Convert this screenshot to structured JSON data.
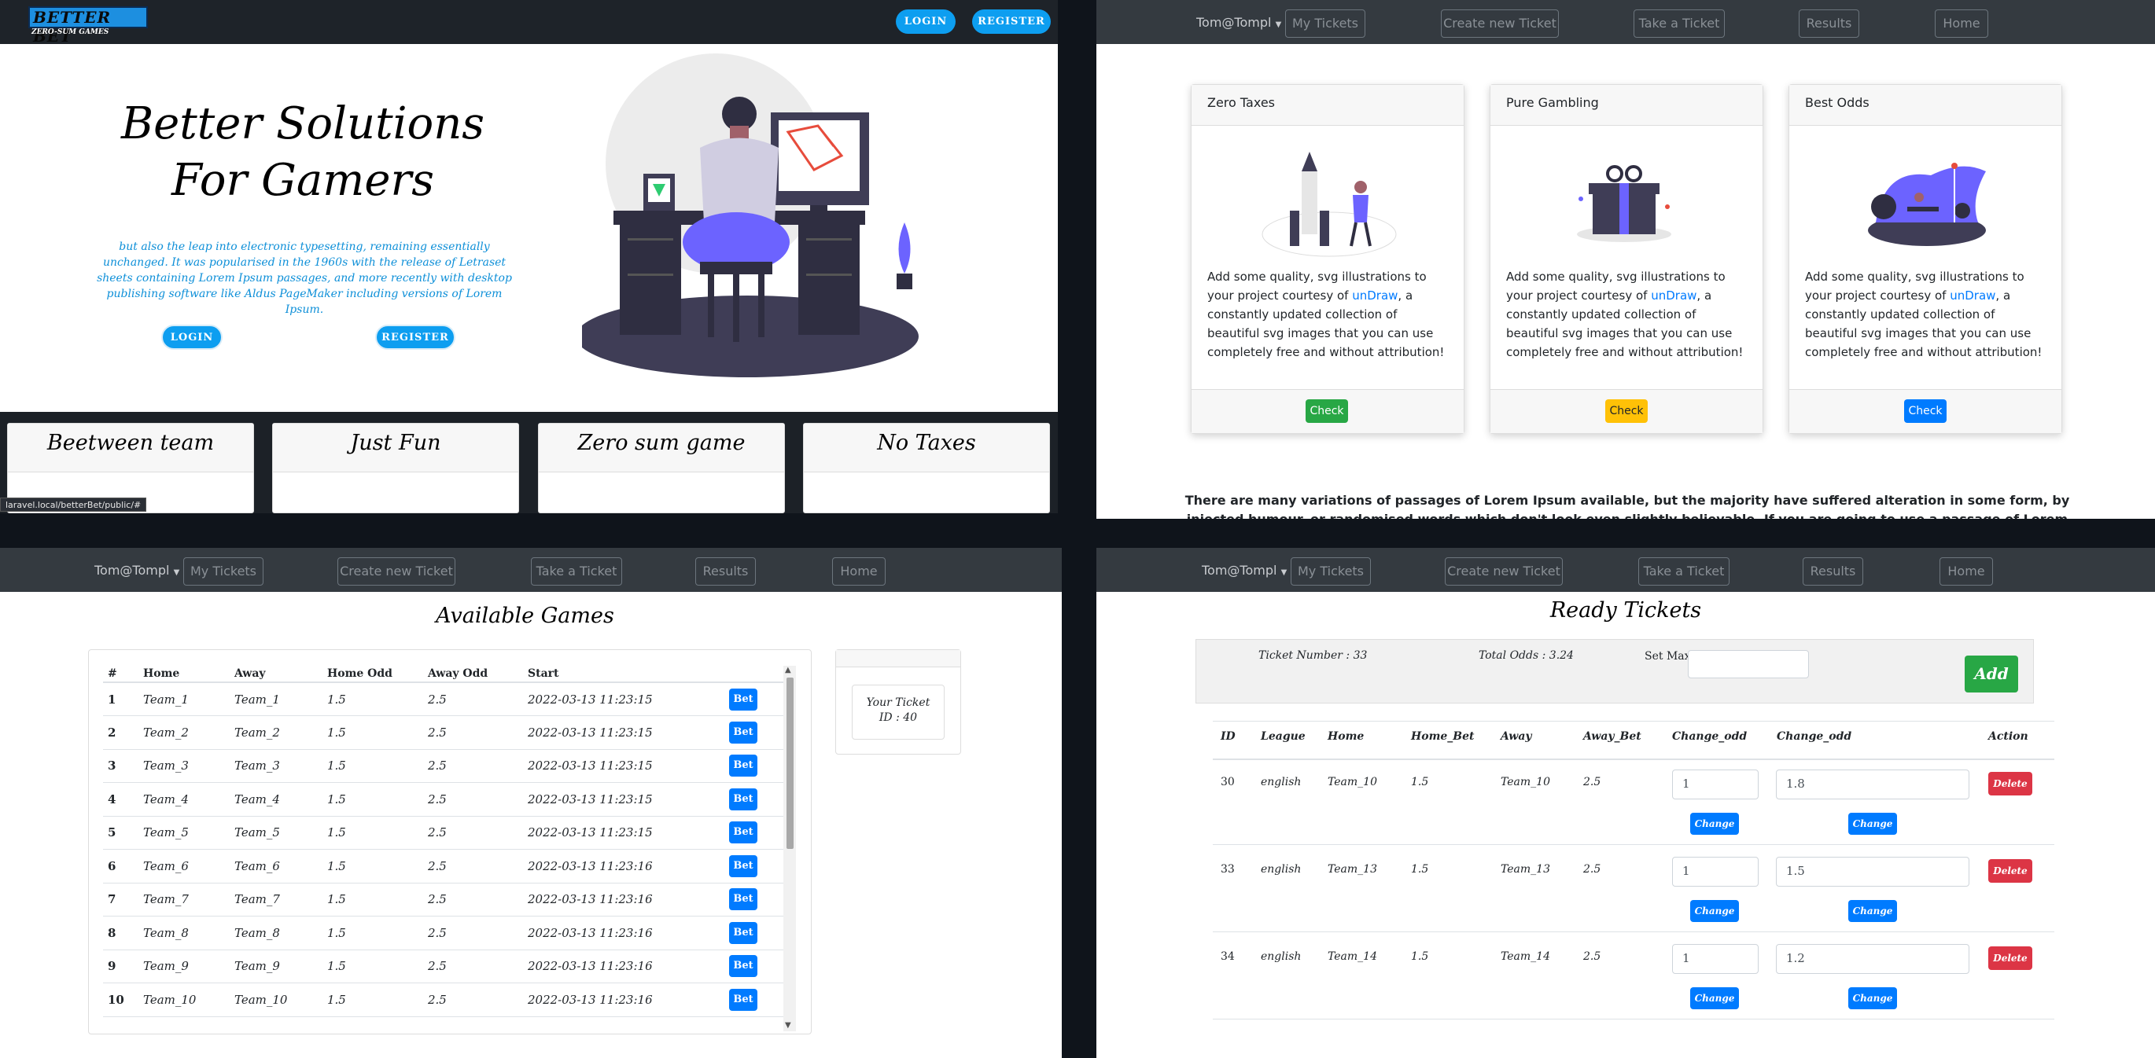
{
  "landing": {
    "brand": "BETTER BET",
    "brand_sub": "ZERO-SUM GAMES",
    "top_login": "LOGIN",
    "top_register": "REGISTER",
    "hero_title": "Better Solutions For Gamers",
    "hero_text": "but also the leap into electronic typesetting, remaining essentially unchanged. It was popularised in the 1960s with the release of Letraset sheets containing Lorem Ipsum passages, and more recently with desktop publishing software like Aldus PageMaker including versions of Lorem Ipsum.",
    "hero_login": "LOGIN",
    "hero_register": "REGISTER",
    "features": [
      "Beetween team",
      "Just Fun",
      "Zero sum game",
      "No Taxes"
    ],
    "status_url": "laravel.local/betterBet/public/#"
  },
  "nav": {
    "user": "Tom@Tompl",
    "items": [
      "My Tickets",
      "Create new Ticket",
      "Take a Ticket",
      "Results",
      "Home"
    ]
  },
  "home": {
    "cards": [
      {
        "title": "Zero Taxes",
        "text_before": "Add some quality, svg illustrations to your project courtesy of ",
        "link": "unDraw",
        "text_after": ", a constantly updated collection of beautiful svg images that you can use completely free and without attribution!",
        "button": "Check",
        "button_color": "#28a745"
      },
      {
        "title": "Pure Gambling",
        "text_before": "Add some quality, svg illustrations to your project courtesy of ",
        "link": "unDraw",
        "text_after": ", a constantly updated collection of beautiful svg images that you can use completely free and without attribution!",
        "button": "Check",
        "button_color": "#ffc107"
      },
      {
        "title": "Best Odds",
        "text_before": "Add some quality, svg illustrations to your project courtesy of ",
        "link": "unDraw",
        "text_after": ", a constantly updated collection of beautiful svg images that you can use completely free and without attribution!",
        "button": "Check",
        "button_color": "#007bff"
      }
    ],
    "lorem": "There are many variations of passages of Lorem Ipsum available, but the majority have suffered alteration in some form, by injected humour, or randomised words which don't look even slightly believable. If you are going to use a passage of Lorem Ipsum, you need to be sure there isn't anything"
  },
  "games": {
    "title": "Available Games",
    "headers": [
      "#",
      "Home",
      "Away",
      "Home Odd",
      "Away Odd",
      "Start"
    ],
    "bet_label": "Bet",
    "rows": [
      [
        "1",
        "Team_1",
        "Team_1",
        "1.5",
        "2.5",
        "2022-03-13 11:23:15"
      ],
      [
        "2",
        "Team_2",
        "Team_2",
        "1.5",
        "2.5",
        "2022-03-13 11:23:15"
      ],
      [
        "3",
        "Team_3",
        "Team_3",
        "1.5",
        "2.5",
        "2022-03-13 11:23:15"
      ],
      [
        "4",
        "Team_4",
        "Team_4",
        "1.5",
        "2.5",
        "2022-03-13 11:23:15"
      ],
      [
        "5",
        "Team_5",
        "Team_5",
        "1.5",
        "2.5",
        "2022-03-13 11:23:15"
      ],
      [
        "6",
        "Team_6",
        "Team_6",
        "1.5",
        "2.5",
        "2022-03-13 11:23:16"
      ],
      [
        "7",
        "Team_7",
        "Team_7",
        "1.5",
        "2.5",
        "2022-03-13 11:23:16"
      ],
      [
        "8",
        "Team_8",
        "Team_8",
        "1.5",
        "2.5",
        "2022-03-13 11:23:16"
      ],
      [
        "9",
        "Team_9",
        "Team_9",
        "1.5",
        "2.5",
        "2022-03-13 11:23:16"
      ],
      [
        "10",
        "Team_10",
        "Team_10",
        "1.5",
        "2.5",
        "2022-03-13 11:23:16"
      ]
    ],
    "ticket_line1": "Your Ticket",
    "ticket_line2": "ID : 40"
  },
  "ready": {
    "title": "Ready Tickets",
    "ticket_number": "Ticket Number : 33",
    "total_odds": "Total Odds : 3.24",
    "set_max": "Set Max bet",
    "add": "Add",
    "headers": [
      "ID",
      "League",
      "Home",
      "Home_Bet",
      "Away",
      "Away_Bet",
      "Change_odd",
      "Change_odd",
      "Action"
    ],
    "change_label": "Change",
    "delete_label": "Delete",
    "rows": [
      {
        "id": "30",
        "league": "english",
        "home": "Team_10",
        "home_bet": "1.5",
        "away": "Team_10",
        "away_bet": "2.5",
        "odd1": "1",
        "odd2": "1.8"
      },
      {
        "id": "33",
        "league": "english",
        "home": "Team_13",
        "home_bet": "1.5",
        "away": "Team_13",
        "away_bet": "2.5",
        "odd1": "1",
        "odd2": "1.5"
      },
      {
        "id": "34",
        "league": "english",
        "home": "Team_14",
        "home_bet": "1.5",
        "away": "Team_14",
        "away_bet": "2.5",
        "odd1": "1",
        "odd2": "1.2"
      }
    ]
  }
}
